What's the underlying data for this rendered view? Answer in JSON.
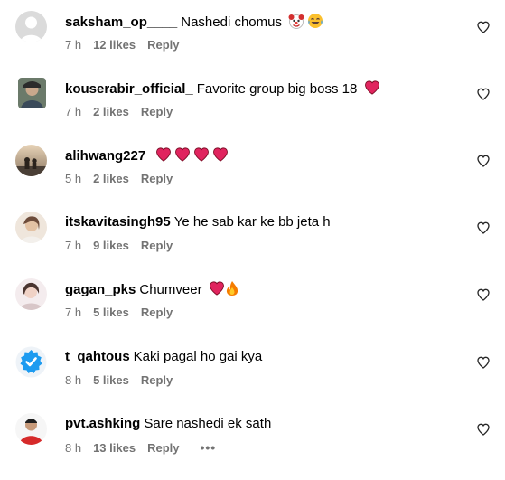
{
  "comments": [
    {
      "username": "saksham_op____",
      "text": "Nashedi chomus",
      "time": "7 h",
      "likes": "12 likes",
      "reply": "Reply",
      "emojis": [
        "clown-face",
        "tears-of-joy"
      ],
      "avatar": "default-avatar"
    },
    {
      "username": "kouserabir_official_",
      "text": "Favorite group big boss 18",
      "time": "7 h",
      "likes": "2 likes",
      "reply": "Reply",
      "emojis": [
        "red-heart"
      ],
      "avatar": "photo-avatar"
    },
    {
      "username": "alihwang227",
      "text": "",
      "time": "5 h",
      "likes": "2 likes",
      "reply": "Reply",
      "emojis": [
        "red-heart",
        "red-heart",
        "red-heart",
        "red-heart"
      ],
      "avatar": "photo-avatar"
    },
    {
      "username": "itskavitasingh95",
      "text": "Ye he sab kar ke bb jeta h",
      "time": "7 h",
      "likes": "9 likes",
      "reply": "Reply",
      "emojis": [],
      "avatar": "photo-avatar"
    },
    {
      "username": "gagan_pks",
      "text": "Chumveer",
      "time": "7 h",
      "likes": "5 likes",
      "reply": "Reply",
      "emojis": [
        "red-heart",
        "fire"
      ],
      "avatar": "photo-avatar"
    },
    {
      "username": "t_qahtous",
      "text": "Kaki pagal ho gai kya",
      "time": "8 h",
      "likes": "5 likes",
      "reply": "Reply",
      "emojis": [],
      "avatar": "verified-badge-avatar"
    },
    {
      "username": "pvt.ashking",
      "text": "Sare nashedi ek sath",
      "time": "8 h",
      "likes": "13 likes",
      "reply": "Reply",
      "emojis": [],
      "avatar": "photo-avatar",
      "more": "•••"
    }
  ],
  "colors": {
    "heart": "#e0245e",
    "meta": "#737373",
    "verified": "#1d9bf0"
  }
}
